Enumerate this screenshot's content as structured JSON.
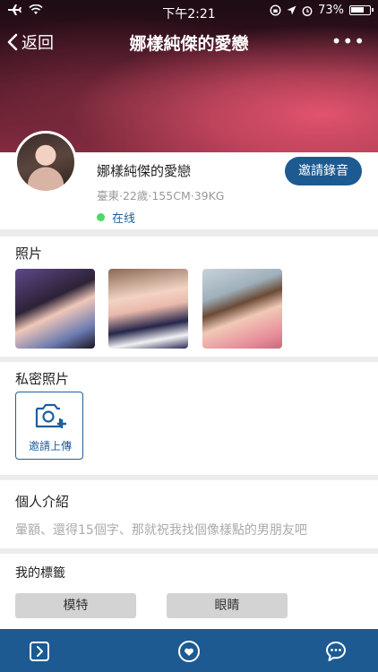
{
  "status_bar": {
    "time": "下午2:21",
    "battery": "73%"
  },
  "nav": {
    "back_label": "返回",
    "title": "娜樣純傑的愛戀",
    "more": "•••"
  },
  "profile": {
    "name": "娜樣純傑的愛戀",
    "meta": "臺東·22歲·155CM·39KG",
    "status": "在线",
    "invite_voice_label": "邀請錄音"
  },
  "photos": {
    "title": "照片",
    "count": 3
  },
  "private_photos": {
    "title": "私密照片",
    "invite_label": "邀請上傳"
  },
  "intro": {
    "title": "個人介紹",
    "text": "暈額、還得15個字、那就祝我找個像樣點的男朋友吧"
  },
  "tags": {
    "title": "我的標籤",
    "items": [
      "模特",
      "眼睛"
    ]
  },
  "colors": {
    "accent": "#1d5a91",
    "online": "#4cd964"
  }
}
